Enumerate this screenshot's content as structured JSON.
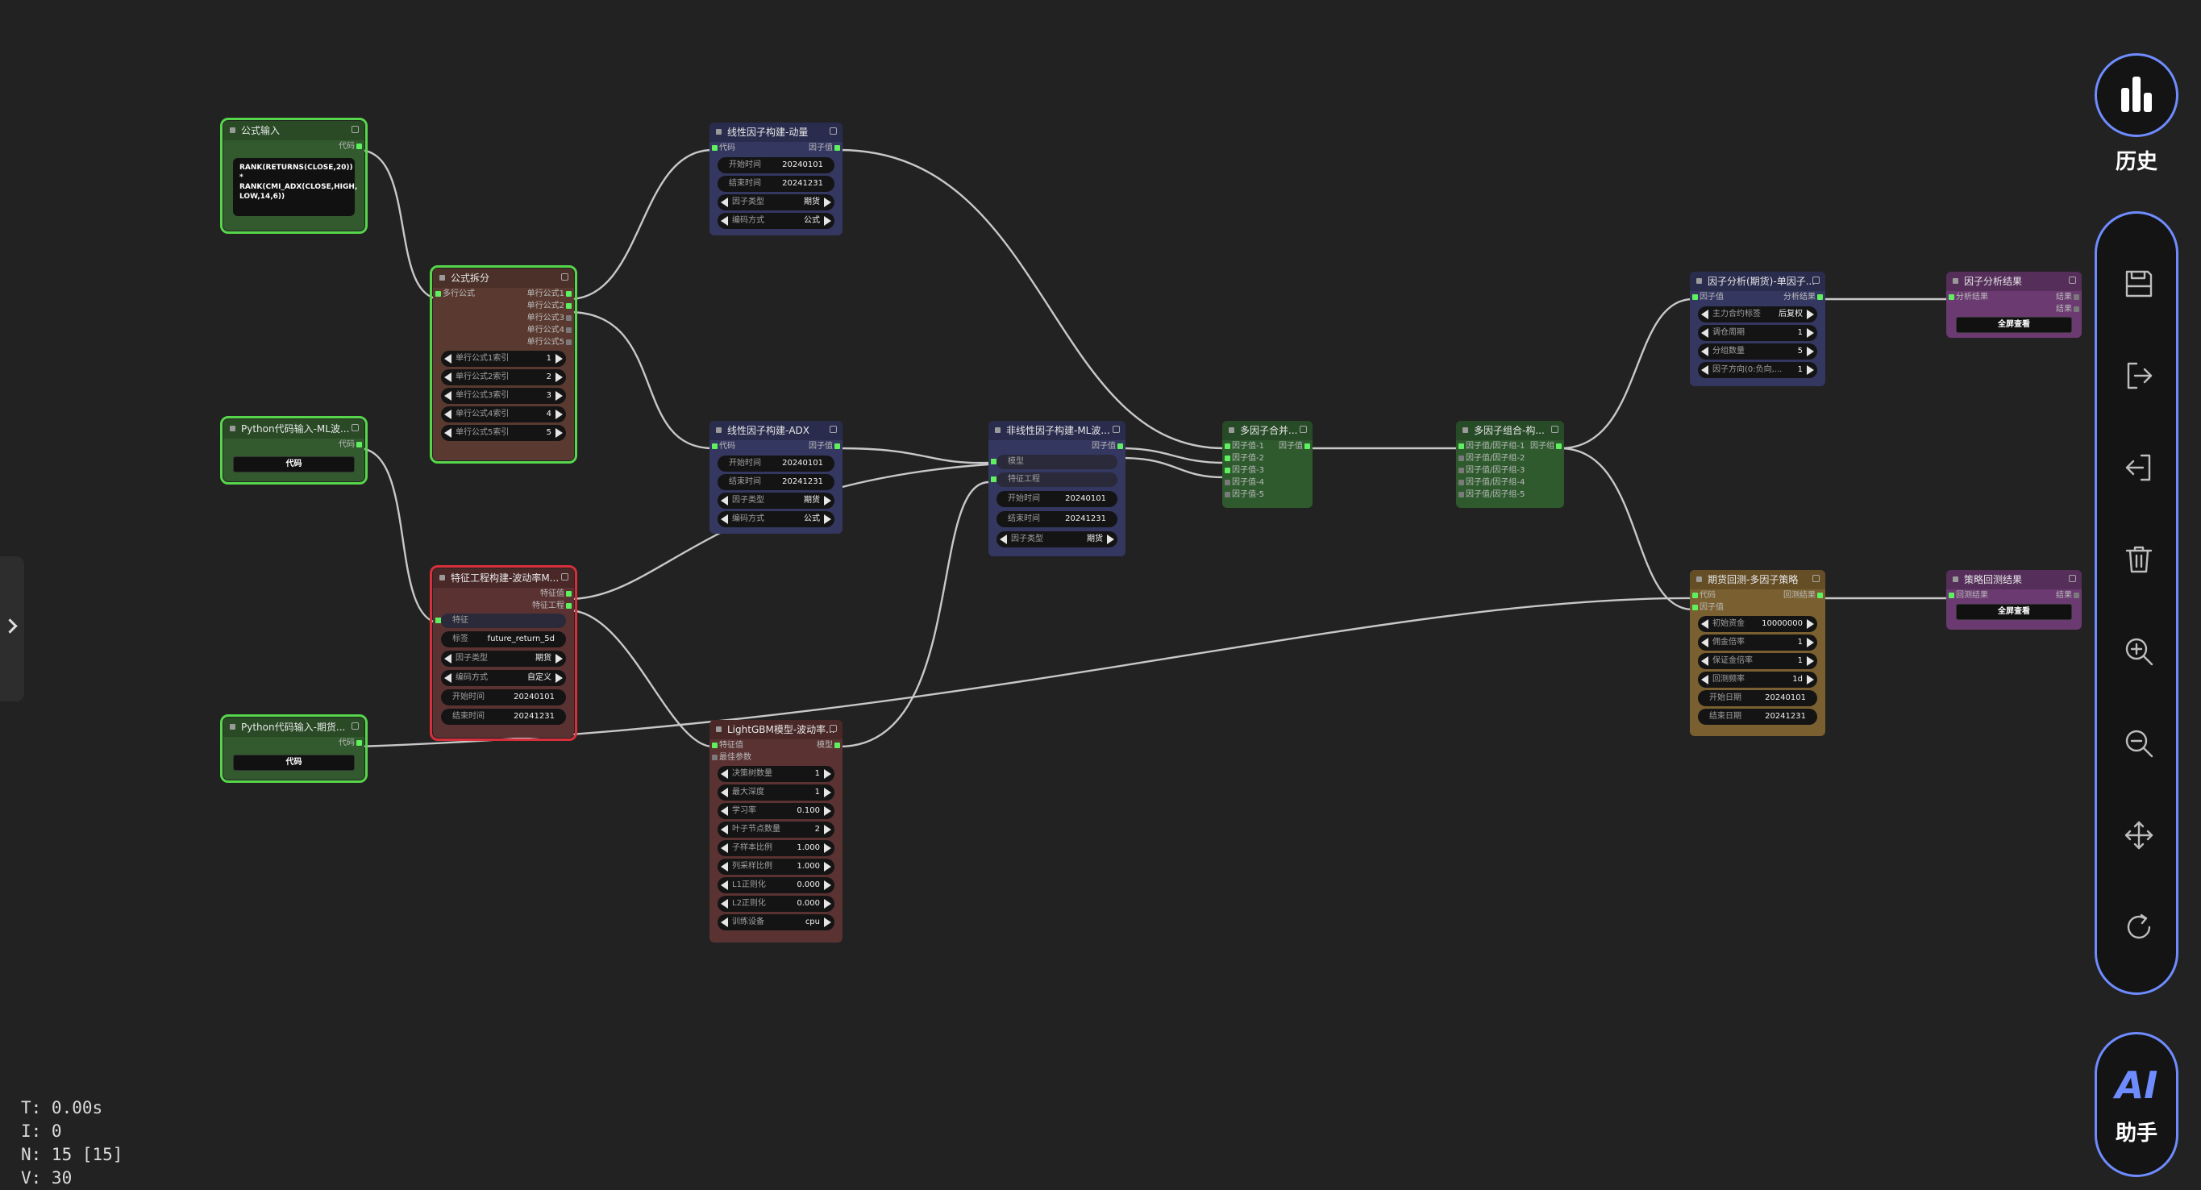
{
  "stats": {
    "t": "T: 0.00s",
    "i": "I: 0",
    "n": "N: 15 [15]",
    "v": "V: 30"
  },
  "right_panel": {
    "history_label": "历史",
    "ai_label": "AI",
    "assistant_label": "助手"
  },
  "colors": {
    "wire": "#c8c8c8",
    "slot_connected": "#5ef05e",
    "accent": "#6f8cff"
  },
  "nodes": {
    "formula_input": {
      "title": "公式输入",
      "output": "代码",
      "text": "RANK(RETURNS(CLOSE,20)) * RANK(CMI_ADX(CLOSE,HIGH, LOW,14,6))"
    },
    "py_ml_wave": {
      "title": "Python代码输入-ML波...",
      "output": "代码",
      "button": "代码"
    },
    "py_futures": {
      "title": "Python代码输入-期货...",
      "output": "代码",
      "button": "代码"
    },
    "formula_split": {
      "title": "公式拆分",
      "input": "多行公式",
      "outputs": [
        "单行公式1",
        "单行公式2",
        "单行公式3",
        "单行公式4",
        "单行公式5"
      ],
      "widgets": [
        {
          "label": "单行公式1索引",
          "value": "1"
        },
        {
          "label": "单行公式2索引",
          "value": "2"
        },
        {
          "label": "单行公式3索引",
          "value": "3"
        },
        {
          "label": "单行公式4索引",
          "value": "4"
        },
        {
          "label": "单行公式5索引",
          "value": "5"
        }
      ]
    },
    "feature_eng": {
      "title": "特征工程构建-波动率M...",
      "outputs": [
        "特征值",
        "特征工程"
      ],
      "input": "特征",
      "widgets": [
        {
          "label": "标签",
          "value": "future_return_5d"
        },
        {
          "label": "因子类型",
          "value": "期货"
        },
        {
          "label": "编码方式",
          "value": "自定义"
        },
        {
          "label": "开始时间",
          "value": "20240101"
        },
        {
          "label": "结束时间",
          "value": "20241231"
        }
      ]
    },
    "linear_momentum": {
      "title": "线性因子构建-动量",
      "input": "代码",
      "output": "因子值",
      "widgets": [
        {
          "label": "开始时间",
          "value": "20240101"
        },
        {
          "label": "结束时间",
          "value": "20241231"
        },
        {
          "label": "因子类型",
          "value": "期货"
        },
        {
          "label": "编码方式",
          "value": "公式"
        }
      ]
    },
    "linear_adx": {
      "title": "线性因子构建-ADX",
      "input": "代码",
      "output": "因子值",
      "widgets": [
        {
          "label": "开始时间",
          "value": "20240101"
        },
        {
          "label": "结束时间",
          "value": "20241231"
        },
        {
          "label": "因子类型",
          "value": "期货"
        },
        {
          "label": "编码方式",
          "value": "公式"
        }
      ]
    },
    "lightgbm": {
      "title": "LightGBM模型-波动率...",
      "inputs": [
        "特征值",
        "最佳参数"
      ],
      "output": "模型",
      "widgets": [
        {
          "label": "决策树数量",
          "value": "1"
        },
        {
          "label": "最大深度",
          "value": "1"
        },
        {
          "label": "学习率",
          "value": "0.100"
        },
        {
          "label": "叶子节点数量",
          "value": "2"
        },
        {
          "label": "子样本比例",
          "value": "1.000"
        },
        {
          "label": "列采样比例",
          "value": "1.000"
        },
        {
          "label": "L1正则化",
          "value": "0.000"
        },
        {
          "label": "L2正则化",
          "value": "0.000"
        },
        {
          "label": "训练设备",
          "value": "cpu"
        }
      ]
    },
    "nonlinear": {
      "title": "非线性因子构建-ML波...",
      "output": "因子值",
      "inputs": [
        "模型",
        "特征工程"
      ],
      "widgets": [
        {
          "label": "开始时间",
          "value": "20240101"
        },
        {
          "label": "结束时间",
          "value": "20241231"
        },
        {
          "label": "因子类型",
          "value": "期货"
        }
      ]
    },
    "multi_merge": {
      "title": "多因子合并...",
      "inputs": [
        "因子值-1",
        "因子值-2",
        "因子值-3",
        "因子值-4",
        "因子值-5"
      ],
      "output": "因子值"
    },
    "multi_combo": {
      "title": "多因子组合-构...",
      "inputs": [
        "因子值/因子组-1",
        "因子值/因子组-2",
        "因子值/因子组-3",
        "因子值/因子组-4",
        "因子值/因子组-5"
      ],
      "output": "因子组"
    },
    "factor_analysis": {
      "title": "因子分析(期货)-单因子...",
      "input": "因子值",
      "output": "分析结果",
      "widgets": [
        {
          "label": "主力合约标签",
          "value": "后复权"
        },
        {
          "label": "调仓周期",
          "value": "1"
        },
        {
          "label": "分组数量",
          "value": "5"
        },
        {
          "label": "因子方向(0:负向,...",
          "value": "1"
        }
      ]
    },
    "factor_result": {
      "title": "因子分析结果",
      "input": "分析结果",
      "outputs": [
        "结果",
        "结果"
      ],
      "button": "全屏查看"
    },
    "backtest": {
      "title": "期货回测-多因子策略",
      "inputs": [
        "代码",
        "因子值"
      ],
      "output": "回测结果",
      "widgets": [
        {
          "label": "初始资金",
          "value": "10000000"
        },
        {
          "label": "佣金倍率",
          "value": "1"
        },
        {
          "label": "保证金倍率",
          "value": "1"
        },
        {
          "label": "回测频率",
          "value": "1d"
        },
        {
          "label": "开始日期",
          "value": "20240101"
        },
        {
          "label": "结束日期",
          "value": "20241231"
        }
      ]
    },
    "backtest_result": {
      "title": "策略回测结果",
      "input": "回测结果",
      "output": "结果",
      "button": "全屏查看"
    }
  }
}
